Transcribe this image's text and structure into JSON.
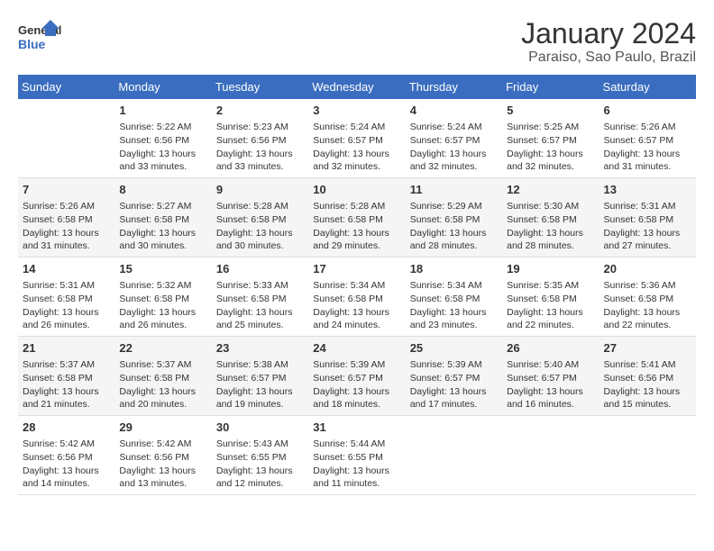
{
  "header": {
    "logo_line1": "General",
    "logo_line2": "Blue",
    "title": "January 2024",
    "subtitle": "Paraiso, Sao Paulo, Brazil"
  },
  "days_of_week": [
    "Sunday",
    "Monday",
    "Tuesday",
    "Wednesday",
    "Thursday",
    "Friday",
    "Saturday"
  ],
  "weeks": [
    [
      {
        "day": "",
        "info": ""
      },
      {
        "day": "1",
        "info": "Sunrise: 5:22 AM\nSunset: 6:56 PM\nDaylight: 13 hours\nand 33 minutes."
      },
      {
        "day": "2",
        "info": "Sunrise: 5:23 AM\nSunset: 6:56 PM\nDaylight: 13 hours\nand 33 minutes."
      },
      {
        "day": "3",
        "info": "Sunrise: 5:24 AM\nSunset: 6:57 PM\nDaylight: 13 hours\nand 32 minutes."
      },
      {
        "day": "4",
        "info": "Sunrise: 5:24 AM\nSunset: 6:57 PM\nDaylight: 13 hours\nand 32 minutes."
      },
      {
        "day": "5",
        "info": "Sunrise: 5:25 AM\nSunset: 6:57 PM\nDaylight: 13 hours\nand 32 minutes."
      },
      {
        "day": "6",
        "info": "Sunrise: 5:26 AM\nSunset: 6:57 PM\nDaylight: 13 hours\nand 31 minutes."
      }
    ],
    [
      {
        "day": "7",
        "info": "Sunrise: 5:26 AM\nSunset: 6:58 PM\nDaylight: 13 hours\nand 31 minutes."
      },
      {
        "day": "8",
        "info": "Sunrise: 5:27 AM\nSunset: 6:58 PM\nDaylight: 13 hours\nand 30 minutes."
      },
      {
        "day": "9",
        "info": "Sunrise: 5:28 AM\nSunset: 6:58 PM\nDaylight: 13 hours\nand 30 minutes."
      },
      {
        "day": "10",
        "info": "Sunrise: 5:28 AM\nSunset: 6:58 PM\nDaylight: 13 hours\nand 29 minutes."
      },
      {
        "day": "11",
        "info": "Sunrise: 5:29 AM\nSunset: 6:58 PM\nDaylight: 13 hours\nand 28 minutes."
      },
      {
        "day": "12",
        "info": "Sunrise: 5:30 AM\nSunset: 6:58 PM\nDaylight: 13 hours\nand 28 minutes."
      },
      {
        "day": "13",
        "info": "Sunrise: 5:31 AM\nSunset: 6:58 PM\nDaylight: 13 hours\nand 27 minutes."
      }
    ],
    [
      {
        "day": "14",
        "info": "Sunrise: 5:31 AM\nSunset: 6:58 PM\nDaylight: 13 hours\nand 26 minutes."
      },
      {
        "day": "15",
        "info": "Sunrise: 5:32 AM\nSunset: 6:58 PM\nDaylight: 13 hours\nand 26 minutes."
      },
      {
        "day": "16",
        "info": "Sunrise: 5:33 AM\nSunset: 6:58 PM\nDaylight: 13 hours\nand 25 minutes."
      },
      {
        "day": "17",
        "info": "Sunrise: 5:34 AM\nSunset: 6:58 PM\nDaylight: 13 hours\nand 24 minutes."
      },
      {
        "day": "18",
        "info": "Sunrise: 5:34 AM\nSunset: 6:58 PM\nDaylight: 13 hours\nand 23 minutes."
      },
      {
        "day": "19",
        "info": "Sunrise: 5:35 AM\nSunset: 6:58 PM\nDaylight: 13 hours\nand 22 minutes."
      },
      {
        "day": "20",
        "info": "Sunrise: 5:36 AM\nSunset: 6:58 PM\nDaylight: 13 hours\nand 22 minutes."
      }
    ],
    [
      {
        "day": "21",
        "info": "Sunrise: 5:37 AM\nSunset: 6:58 PM\nDaylight: 13 hours\nand 21 minutes."
      },
      {
        "day": "22",
        "info": "Sunrise: 5:37 AM\nSunset: 6:58 PM\nDaylight: 13 hours\nand 20 minutes."
      },
      {
        "day": "23",
        "info": "Sunrise: 5:38 AM\nSunset: 6:57 PM\nDaylight: 13 hours\nand 19 minutes."
      },
      {
        "day": "24",
        "info": "Sunrise: 5:39 AM\nSunset: 6:57 PM\nDaylight: 13 hours\nand 18 minutes."
      },
      {
        "day": "25",
        "info": "Sunrise: 5:39 AM\nSunset: 6:57 PM\nDaylight: 13 hours\nand 17 minutes."
      },
      {
        "day": "26",
        "info": "Sunrise: 5:40 AM\nSunset: 6:57 PM\nDaylight: 13 hours\nand 16 minutes."
      },
      {
        "day": "27",
        "info": "Sunrise: 5:41 AM\nSunset: 6:56 PM\nDaylight: 13 hours\nand 15 minutes."
      }
    ],
    [
      {
        "day": "28",
        "info": "Sunrise: 5:42 AM\nSunset: 6:56 PM\nDaylight: 13 hours\nand 14 minutes."
      },
      {
        "day": "29",
        "info": "Sunrise: 5:42 AM\nSunset: 6:56 PM\nDaylight: 13 hours\nand 13 minutes."
      },
      {
        "day": "30",
        "info": "Sunrise: 5:43 AM\nSunset: 6:55 PM\nDaylight: 13 hours\nand 12 minutes."
      },
      {
        "day": "31",
        "info": "Sunrise: 5:44 AM\nSunset: 6:55 PM\nDaylight: 13 hours\nand 11 minutes."
      },
      {
        "day": "",
        "info": ""
      },
      {
        "day": "",
        "info": ""
      },
      {
        "day": "",
        "info": ""
      }
    ]
  ]
}
